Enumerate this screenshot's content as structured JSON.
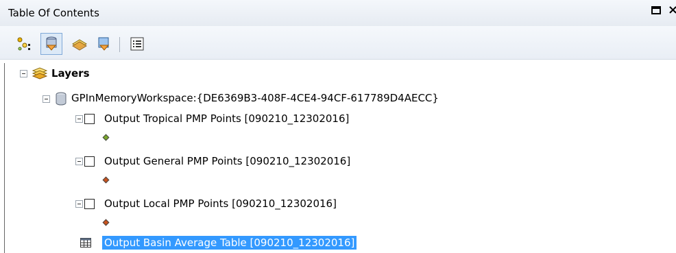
{
  "window": {
    "title": "Table Of Contents"
  },
  "toolbar": {
    "buttons": [
      {
        "name": "List By Drawing Order",
        "icon": "list-by-drawing-order-icon"
      },
      {
        "name": "List By Source",
        "icon": "list-by-source-icon"
      },
      {
        "name": "List By Visibility",
        "icon": "list-by-visibility-icon"
      },
      {
        "name": "List By Selection",
        "icon": "list-by-selection-icon"
      },
      {
        "name": "Options",
        "icon": "options-icon"
      }
    ]
  },
  "tree": {
    "root": {
      "label": "Layers"
    },
    "workspace": {
      "label": "GPInMemoryWorkspace:{DE6369B3-408F-4CE4-94CF-617789D4AECC}"
    },
    "layers": [
      {
        "label": "Output Tropical PMP Points [090210_12302016]",
        "symbol_color": "#7aa82b",
        "checked": false
      },
      {
        "label": "Output General PMP Points [090210_12302016]",
        "symbol_color": "#c9531d",
        "checked": false
      },
      {
        "label": "Output Local PMP Points [090210_12302016]",
        "symbol_color": "#c9531d",
        "checked": false
      }
    ],
    "table": {
      "label": "Output Basin Average Table [090210_12302016]",
      "selected": true
    }
  },
  "colors": {
    "selection": "#3399ff",
    "title_bar": "#e9eef5"
  }
}
